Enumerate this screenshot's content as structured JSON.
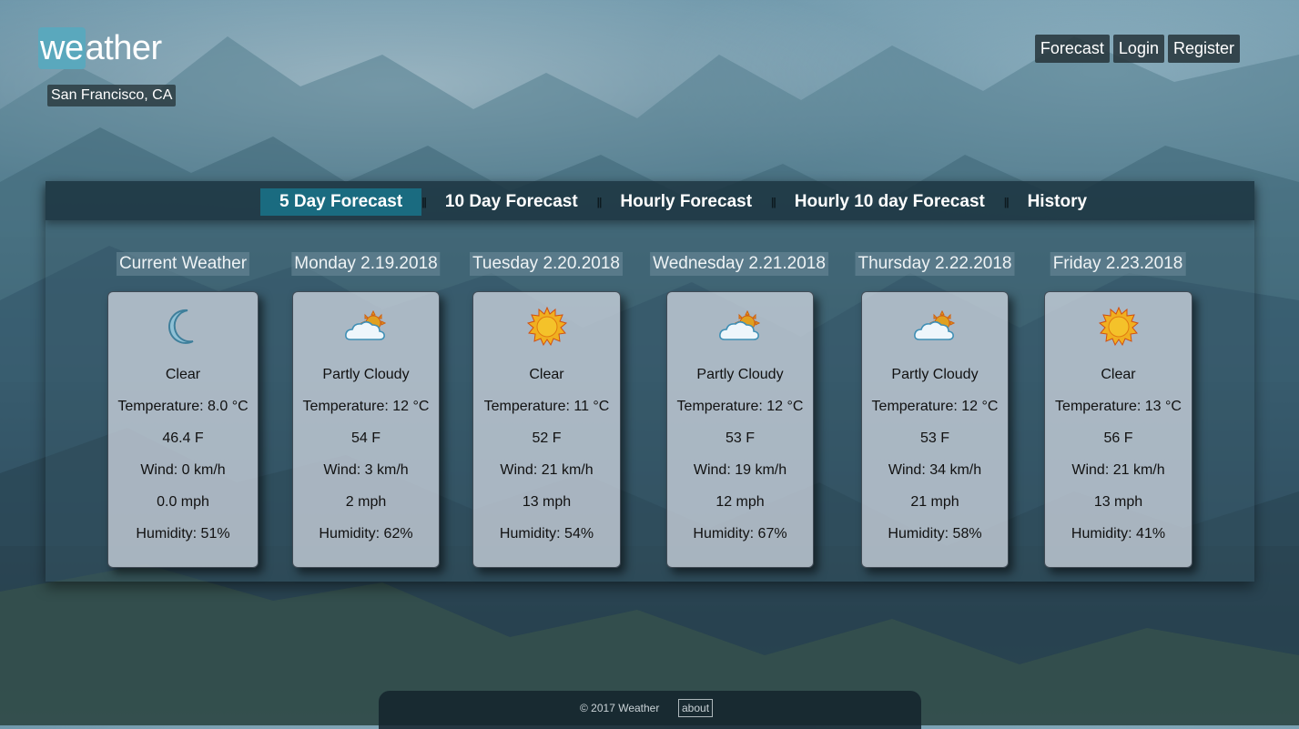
{
  "brand": {
    "logo_highlight": "we",
    "logo_rest": "ather",
    "accent_color": "#5aa8bd"
  },
  "location": "San Francisco, CA",
  "top_nav": [
    "Forecast",
    "Login",
    "Register"
  ],
  "tabs": [
    {
      "label": "5 Day Forecast",
      "active": true
    },
    {
      "label": "10 Day Forecast",
      "active": false
    },
    {
      "label": "Hourly Forecast",
      "active": false
    },
    {
      "label": "Hourly 10 day Forecast",
      "active": false
    },
    {
      "label": "History",
      "active": false
    }
  ],
  "tab_separator": "||",
  "days": [
    {
      "title": "Current Weather",
      "icon": "moon-icon",
      "condition": "Clear",
      "temp_c": "Temperature: 8.0 °C",
      "temp_f": "46.4 F",
      "wind_kmh": "Wind: 0 km/h",
      "wind_mph": "0.0 mph",
      "humidity": "Humidity: 51%"
    },
    {
      "title": "Monday 2.19.2018",
      "icon": "partly-cloudy-icon",
      "condition": "Partly Cloudy",
      "temp_c": "Temperature: 12 °C",
      "temp_f": "54 F",
      "wind_kmh": "Wind: 3 km/h",
      "wind_mph": "2 mph",
      "humidity": "Humidity: 62%"
    },
    {
      "title": "Tuesday 2.20.2018",
      "icon": "sun-icon",
      "condition": "Clear",
      "temp_c": "Temperature: 11 °C",
      "temp_f": "52 F",
      "wind_kmh": "Wind: 21 km/h",
      "wind_mph": "13 mph",
      "humidity": "Humidity: 54%"
    },
    {
      "title": "Wednesday 2.21.2018",
      "icon": "partly-cloudy-icon",
      "condition": "Partly Cloudy",
      "temp_c": "Temperature: 12 °C",
      "temp_f": "53 F",
      "wind_kmh": "Wind: 19 km/h",
      "wind_mph": "12 mph",
      "humidity": "Humidity: 67%"
    },
    {
      "title": "Thursday 2.22.2018",
      "icon": "partly-cloudy-icon",
      "condition": "Partly Cloudy",
      "temp_c": "Temperature: 12 °C",
      "temp_f": "53 F",
      "wind_kmh": "Wind: 34 km/h",
      "wind_mph": "21 mph",
      "humidity": "Humidity: 58%"
    },
    {
      "title": "Friday 2.23.2018",
      "icon": "sun-icon",
      "condition": "Clear",
      "temp_c": "Temperature: 13 °C",
      "temp_f": "56 F",
      "wind_kmh": "Wind: 21 km/h",
      "wind_mph": "13 mph",
      "humidity": "Humidity: 41%"
    }
  ],
  "footer": {
    "copyright": "© 2017 Weather",
    "about": "about"
  }
}
